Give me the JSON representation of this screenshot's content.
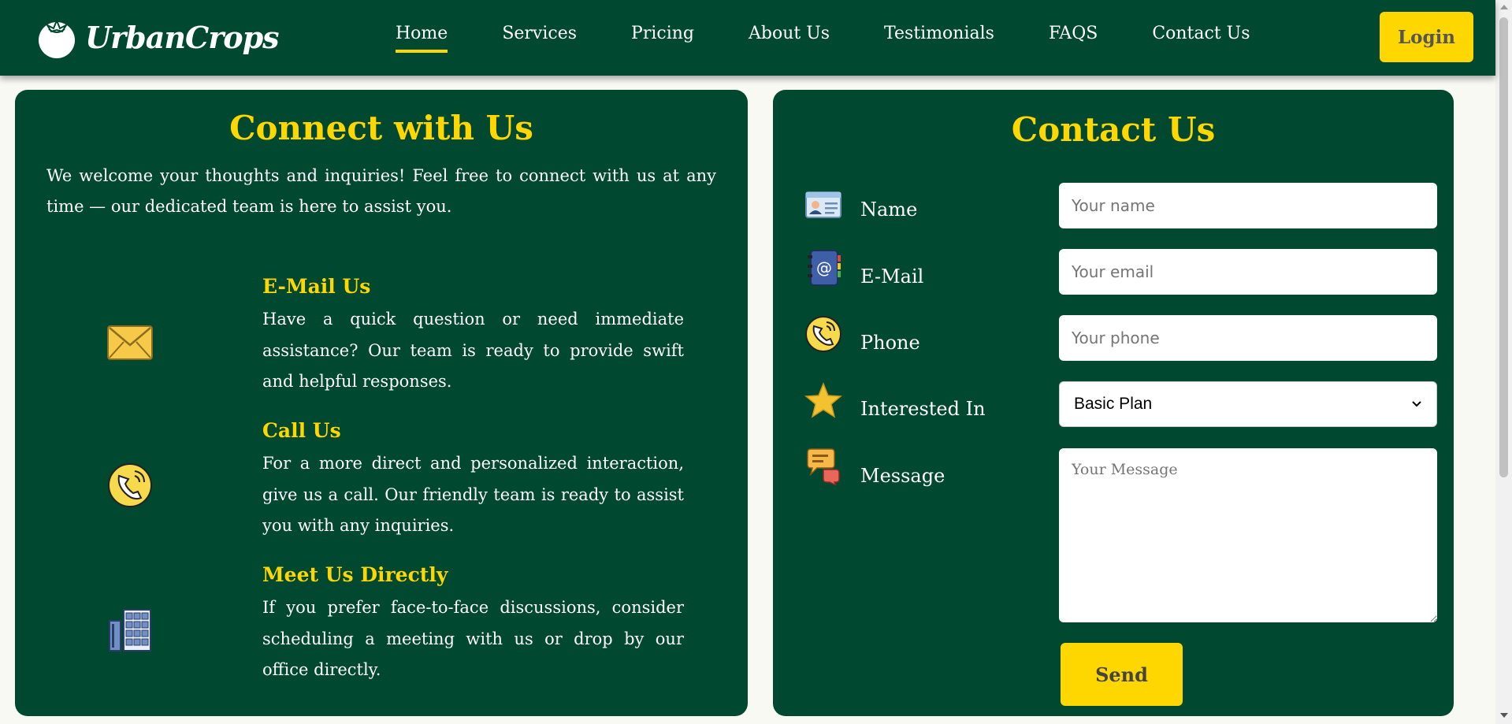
{
  "brand": {
    "name": "UrbanCrops"
  },
  "nav": {
    "links": [
      {
        "label": "Home"
      },
      {
        "label": "Services"
      },
      {
        "label": "Pricing"
      },
      {
        "label": "About Us"
      },
      {
        "label": "Testimonials"
      },
      {
        "label": "FAQS"
      },
      {
        "label": "Contact Us"
      }
    ],
    "active": "Home",
    "login_label": "Login"
  },
  "connect": {
    "title": "Connect with Us",
    "intro": "We welcome your thoughts and inquiries! Feel free to connect with us at any time — our dedicated team is here to assist you.",
    "items": [
      {
        "icon": "envelope-icon",
        "heading": "E-Mail Us",
        "text": "Have a quick question or need immediate assistance? Our team is ready to provide swift and helpful responses."
      },
      {
        "icon": "phone-icon",
        "heading": "Call Us",
        "text": "For a more direct and personalized interaction, give us a call. Our friendly team is ready to assist you with any inquiries."
      },
      {
        "icon": "office-building-icon",
        "heading": "Meet Us Directly",
        "text": "If you prefer face-to-face discussions, consider scheduling a meeting with us or drop by our office directly."
      }
    ]
  },
  "contact_form": {
    "title": "Contact Us",
    "name": {
      "label": "Name",
      "placeholder": "Your name",
      "icon": "id-card-icon"
    },
    "email": {
      "label": "E-Mail",
      "placeholder": "Your email",
      "icon": "address-book-icon"
    },
    "phone": {
      "label": "Phone",
      "placeholder": "Your phone",
      "icon": "phone-icon"
    },
    "interest": {
      "label": "Interested In",
      "selected": "Basic Plan",
      "icon": "star-icon"
    },
    "message": {
      "label": "Message",
      "placeholder": "Your Message",
      "icon": "speech-bubbles-icon"
    },
    "send_label": "Send"
  },
  "colors": {
    "brand_green": "#004830",
    "accent_yellow": "#ffd700",
    "page_bg": "#f9f9f4"
  }
}
